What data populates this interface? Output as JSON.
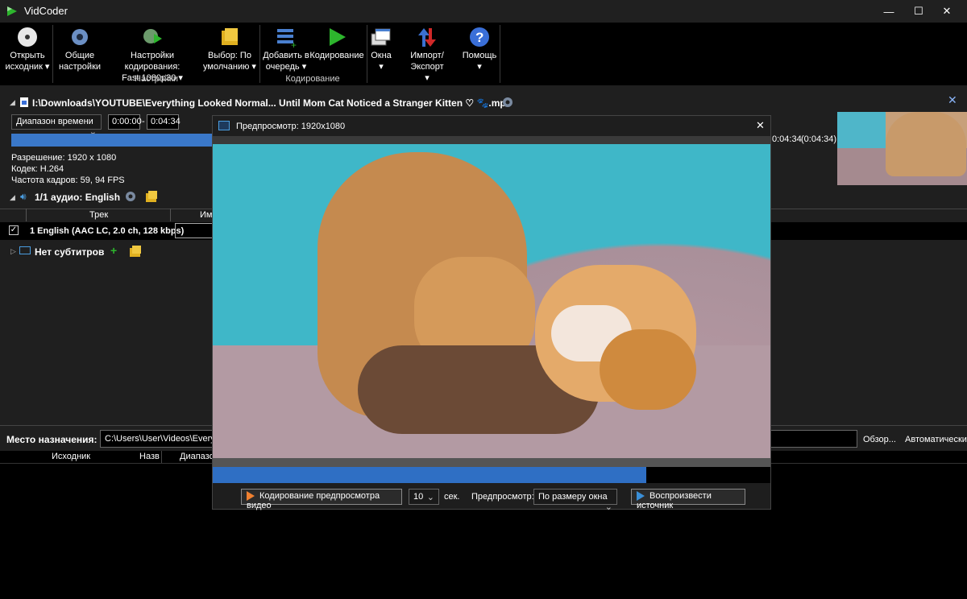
{
  "window": {
    "title": "VidCoder",
    "minimize": "—",
    "maximize": "☐",
    "close": "✕"
  },
  "ribbon": {
    "open_source": [
      "Открыть",
      "исходник ▾"
    ],
    "general_settings": [
      "Общие",
      "настройки"
    ],
    "encoding_settings": [
      "Настройки кодирования:",
      "Fast 1080p30 ▾"
    ],
    "preset": [
      "Выбор: По",
      "умолчанию ▾"
    ],
    "add_queue": [
      "Добавить в",
      "очередь ▾"
    ],
    "encode": "Кодирование",
    "windows": [
      "Окна",
      "▾"
    ],
    "import_export": [
      "Импорт/Экспорт",
      "▾"
    ],
    "help": [
      "Помощь",
      "▾"
    ],
    "group_settings": "Настройки",
    "group_encoding": "Кодирование"
  },
  "source": {
    "path": "I:\\Downloads\\YOUTUBE\\Everything Looked Normal... Until Mom Cat Noticed a Stranger Kitten ♡ 🐾.mp4",
    "range_mode": "Диапазон времени",
    "start": "0:00:00",
    "dash": "-",
    "end": "0:04:34",
    "end_time_right": "0:04:34",
    "duration_right": "(0:04:34)",
    "resolution": "Разрешение: 1920 x 1080",
    "codec": "Кодек: H.264",
    "fps": "Частота кадров: 59, 94 FPS"
  },
  "audio": {
    "header": "1/1 аудио: English",
    "col_track": "Трек",
    "col_name": "Им",
    "track": "1 English (AAC LC, 2.0 ch, 128 kbps)"
  },
  "subtitles": {
    "header": "Нет субтитров"
  },
  "destination": {
    "label": "Место назначения:",
    "path": "C:\\Users\\User\\Videos\\Everythin",
    "browse": "Обзор...",
    "auto": "Автоматически"
  },
  "queue": {
    "col_source": "Исходник",
    "col_name": "Назв",
    "col_range": "Диапазо"
  },
  "preview": {
    "title": "Предпросмотр: 1920x1080",
    "close": "✕",
    "encode_preview": "Кодирование предпросмотра видео",
    "seconds_value": "10",
    "seconds_unit": "сек.",
    "preview_label": "Предпросмотр:",
    "preview_mode": "По размеру окна",
    "play_source": "Воспроизвести источник"
  },
  "colors": {
    "accent": "#2f6fc4",
    "encode_green": "#2db52d"
  }
}
